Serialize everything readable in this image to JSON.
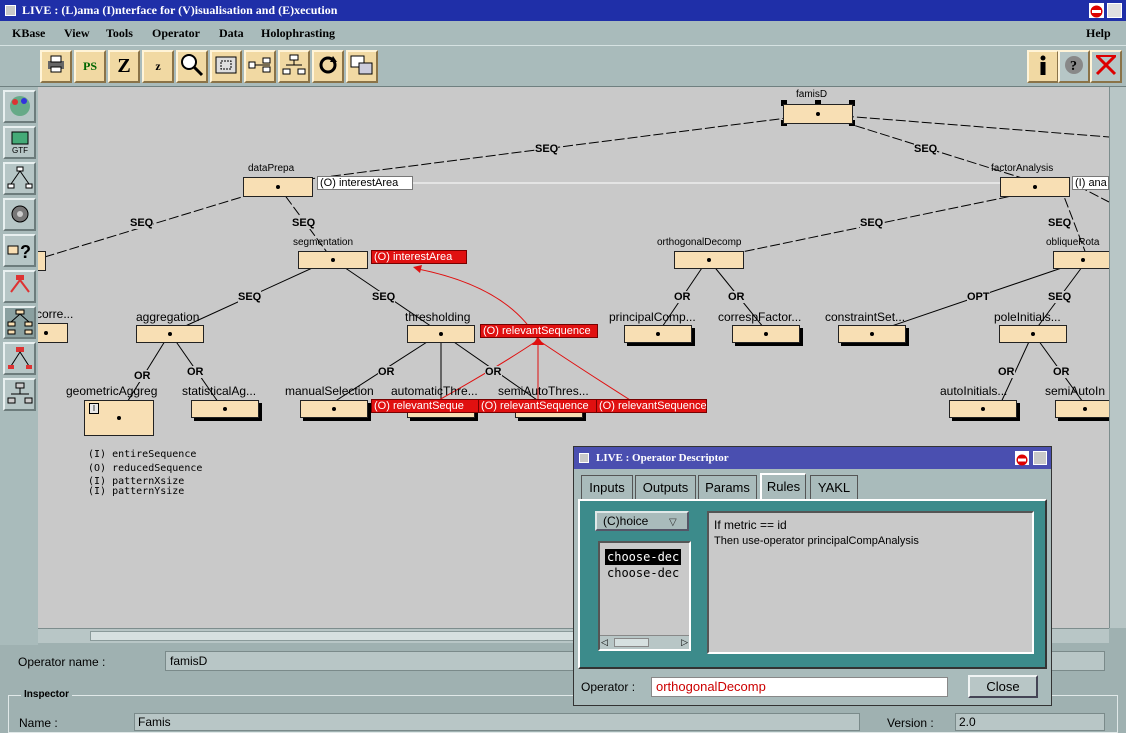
{
  "window": {
    "title": "LIVE : (L)ama (I)nterface for (V)isualisation and (E)xecution"
  },
  "menu": [
    "KBase",
    "View",
    "Tools",
    "Operator",
    "Data",
    "Holophrasting"
  ],
  "menu_help": "Help",
  "toolbar": {
    "ps": "PS",
    "z_big": "Z",
    "z_small": "z"
  },
  "tree": {
    "root": "famisD",
    "dataPrepa": "dataPrepa",
    "dataPrepa_out": "(O) interestArea",
    "factorAnalysis": "factorAnalysis",
    "factorAnalysis_out": "(I) ana",
    "segmentation": "segmentation",
    "segmentation_out": "(O) interestArea",
    "orthogonalDecomp": "orthogonalDecomp",
    "obliqueRota": "obliqueRota",
    "corre": "corre...",
    "aggregation": "aggregation",
    "thresholding": "thresholding",
    "thresholding_out": "(O) relevantSequence",
    "principalComp": "principalComp...",
    "correspFactor": "correspFactor...",
    "constraintSet": "constraintSet...",
    "poleInitials": "poleInitials...",
    "geometricAggreg": "geometricAggreg",
    "statisticalAg": "statisticalAg...",
    "manualSelection": "manualSelection",
    "automaticThre": "automaticThre...",
    "semiAutoThres": "semiAutoThres...",
    "autoInitials": "autoInitials...",
    "semiAutoIn": "semiAutoIn",
    "red1": "(O) relevantSeque",
    "red2": "(O) relevantSequence",
    "red3": "(O) relevantSequence",
    "edge_seq": "SEQ",
    "edge_or": "OR",
    "edge_opt": "OPT",
    "geo_badge": "I"
  },
  "legend": [
    "(I)  entireSequence",
    "(O)  reducedSequence",
    "(I)  patternXsize",
    "(I)  patternYsize"
  ],
  "operator_name": {
    "label": "Operator name :",
    "value": "famisD"
  },
  "inspector": {
    "title": "Inspector",
    "name_label": "Name :",
    "name_value": "Famis",
    "version_label": "Version :",
    "version_value": "2.0"
  },
  "dialog": {
    "title": "LIVE : Operator Descriptor",
    "tabs": [
      "Inputs",
      "Outputs",
      "Params",
      "Rules",
      "YAKL"
    ],
    "active_tab": "Rules",
    "choice": "(C)hoice",
    "rules": [
      "choose-dec",
      "choose-dec"
    ],
    "rule_text_1": "If metric == id",
    "rule_text_2": "Then use-operator principalCompAnalysis",
    "operator_label": "Operator :",
    "operator_value": "orthogonalDecomp",
    "close": "Close"
  },
  "colors": {
    "node": "#f8dfb4",
    "red": "#e01010",
    "canvas": "#c9c9c9",
    "title": "#1f2fa8"
  }
}
